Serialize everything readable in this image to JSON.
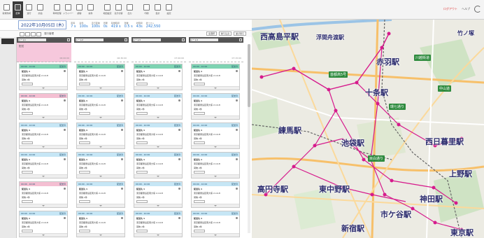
{
  "toolbar": {
    "buttons": [
      {
        "label": "新規作成",
        "icon": "new-doc-icon"
      },
      {
        "label": "配車",
        "icon": "dispatch-icon",
        "active": true
      },
      {
        "label": "運行",
        "icon": "route-icon"
      },
      {
        "label": "計画",
        "icon": "plan-icon"
      },
      {
        "label": "車両管理",
        "icon": "vehicle-icon"
      },
      {
        "label": "ドライバー",
        "icon": "driver-icon"
      },
      {
        "label": "顧客",
        "icon": "customer-icon"
      },
      {
        "label": "案件",
        "icon": "case-icon"
      },
      {
        "label": "地図設定",
        "icon": "map-settings-icon"
      },
      {
        "label": "表示切替",
        "icon": "display-icon"
      },
      {
        "label": "出力",
        "icon": "export-icon"
      },
      {
        "label": "印刷",
        "icon": "print-icon"
      },
      {
        "label": "集計",
        "icon": "summary-icon"
      },
      {
        "label": "設定",
        "icon": "settings-icon"
      }
    ],
    "right_links": [
      "ログアウト",
      "ヘルプ"
    ]
  },
  "info": {
    "date": "2022年10月05日 (木)",
    "stats": [
      {
        "key": "車両",
        "value": "7 s"
      },
      {
        "key": "案件",
        "value": "100s"
      },
      {
        "key": "走行距離",
        "value": "100s"
      },
      {
        "key": "所要",
        "value": "0s"
      },
      {
        "key": "稼働時間",
        "value": "419 s"
      },
      {
        "key": "残業",
        "value": "0.5 s"
      },
      {
        "key": "総時間",
        "value": "43s"
      },
      {
        "key": "総コスト",
        "value": "242,550"
      }
    ]
  },
  "controls": {
    "label": "運行管理",
    "right_boxes": [
      "全選択",
      "絞り込み",
      "並び替え"
    ]
  },
  "columns": [
    {
      "title": "ルート1",
      "top_text": "配送",
      "top_note": "06:00:00"
    },
    {
      "title": "ルート2",
      "top_text": "",
      "top_note": "06:30:00"
    },
    {
      "title": "ルート3",
      "top_text": "",
      "top_note": "07:00:00"
    },
    {
      "title": "ルート4",
      "top_text": "",
      "top_note": "07:15:00"
    }
  ],
  "cards": {
    "header_time": "09:00 - 10:00",
    "header_status": "配送済",
    "line_title": "配送先 1",
    "line_address": "東京都豊島区南大塚 2-14-8",
    "line_product": "荷物 2件"
  },
  "map": {
    "stations": [
      "西高島平駅",
      "赤羽駅",
      "十条駅",
      "練馬駅",
      "池袋駅",
      "西日暮里駅",
      "高円寺駅",
      "東中野駅",
      "新宿駅",
      "上野駅",
      "市ケ谷駅",
      "神田駅",
      "東京駅",
      "竹ノ塚",
      "浮間舟渡駅"
    ],
    "roads": [
      "首都高5号",
      "川越街道",
      "環七通り",
      "目白通り",
      "中山道"
    ],
    "colors": {
      "route": "#d61a8c",
      "park": "#b9dcb0",
      "road": "#f7c06a"
    }
  }
}
